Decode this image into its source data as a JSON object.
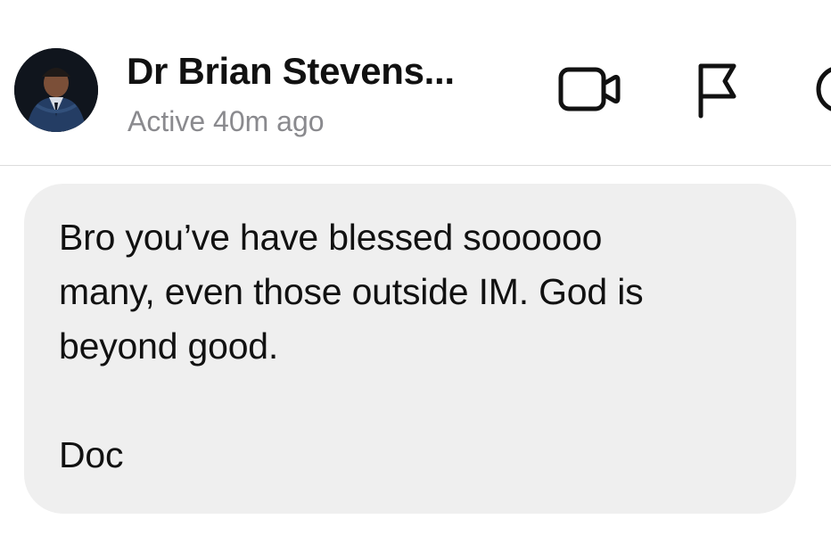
{
  "header": {
    "contact_name": "Dr Brian Stevens...",
    "status": "Active 40m ago",
    "icons": {
      "avatar": "profile-photo",
      "video": "video-camera-icon",
      "flag": "flag-icon",
      "info": "info-icon"
    }
  },
  "messages": [
    {
      "text": "Bro you’ve have blessed soooooo\nmany, even those outside IM. God is\nbeyond good.\n\nDoc"
    }
  ],
  "colors": {
    "bubble_background": "#efefef",
    "status_text": "#8a8a8e",
    "primary_text": "#111111",
    "divider": "#dcdcdc"
  }
}
